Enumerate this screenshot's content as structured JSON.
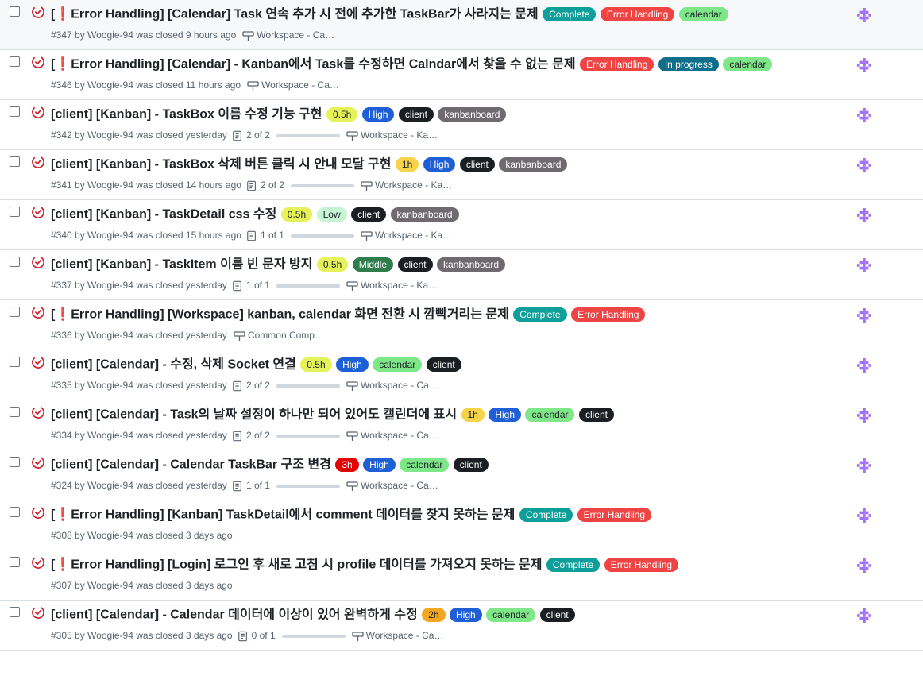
{
  "colors": {
    "status_closed": "#cf222e",
    "avatar": "#a371f7"
  },
  "labels": {
    "complete": {
      "bg": "#0e9f9a",
      "fg": "#ffffff"
    },
    "error_handling": {
      "bg": "#ef4444",
      "fg": "#ffffff"
    },
    "calendar": {
      "bg": "#7ee787",
      "fg": "#1f2328"
    },
    "in_progress": {
      "bg": "#0e6e8c",
      "fg": "#ffffff"
    },
    "h05": {
      "bg": "#e6f25a",
      "fg": "#1f2328"
    },
    "h1": {
      "bg": "#f6d349",
      "fg": "#1f2328"
    },
    "h2": {
      "bg": "#f5a623",
      "fg": "#1f2328"
    },
    "h3": {
      "bg": "#e50000",
      "fg": "#ffffff"
    },
    "high": {
      "bg": "#1f5fd6",
      "fg": "#ffffff"
    },
    "low": {
      "bg": "#c6f5d3",
      "fg": "#1f2328"
    },
    "middle": {
      "bg": "#2f7d4b",
      "fg": "#ffffff"
    },
    "client": {
      "bg": "#1b1f24",
      "fg": "#ffffff"
    },
    "kanbanboard": {
      "bg": "#6e6a70",
      "fg": "#ffffff"
    }
  },
  "issues": [
    {
      "title": "[❗Error Handling] [Calendar] Task 연속 추가 시 전에 추가한 TaskBar가 사라지는 문제",
      "labels": [
        {
          "text": "Complete",
          "style": "complete"
        },
        {
          "text": "Error Handling",
          "style": "error_handling"
        },
        {
          "text": "calendar",
          "style": "calendar"
        }
      ],
      "number": "#347",
      "meta": "by Woogie-94 was closed 9 hours ago",
      "tasks": null,
      "progress": null,
      "project": "Workspace - Ca…",
      "highlight": true
    },
    {
      "title": "[❗Error Handling] [Calendar] - Kanban에서 Task를 수정하면 Calndar에서 찾을 수 없는 문제",
      "labels": [
        {
          "text": "Error Handling",
          "style": "error_handling"
        },
        {
          "text": "In progress",
          "style": "in_progress"
        },
        {
          "text": "calendar",
          "style": "calendar"
        }
      ],
      "number": "#346",
      "meta": "by Woogie-94 was closed 11 hours ago",
      "tasks": null,
      "progress": null,
      "project": "Workspace - Ca…",
      "highlight": false
    },
    {
      "title": "[client] [Kanban] - TaskBox 이름 수정 기능 구현",
      "labels": [
        {
          "text": "0.5h",
          "style": "h05"
        },
        {
          "text": "High",
          "style": "high"
        },
        {
          "text": "client",
          "style": "client"
        },
        {
          "text": "kanbanboard",
          "style": "kanbanboard"
        }
      ],
      "number": "#342",
      "meta": "by Woogie-94 was closed yesterday",
      "tasks": "2 of 2",
      "progress": 1,
      "project": "Workspace - Ka…",
      "highlight": false
    },
    {
      "title": "[client] [Kanban] - TaskBox 삭제 버튼 클릭 시 안내 모달 구현",
      "labels": [
        {
          "text": "1h",
          "style": "h1"
        },
        {
          "text": "High",
          "style": "high"
        },
        {
          "text": "client",
          "style": "client"
        },
        {
          "text": "kanbanboard",
          "style": "kanbanboard"
        }
      ],
      "number": "#341",
      "meta": "by Woogie-94 was closed 14 hours ago",
      "tasks": "2 of 2",
      "progress": 1,
      "project": "Workspace - Ka…",
      "highlight": false
    },
    {
      "title": "[client] [Kanban] - TaskDetail css 수정",
      "labels": [
        {
          "text": "0.5h",
          "style": "h05"
        },
        {
          "text": "Low",
          "style": "low"
        },
        {
          "text": "client",
          "style": "client"
        },
        {
          "text": "kanbanboard",
          "style": "kanbanboard"
        }
      ],
      "number": "#340",
      "meta": "by Woogie-94 was closed 15 hours ago",
      "tasks": "1 of 1",
      "progress": 1,
      "project": "Workspace - Ka…",
      "highlight": false
    },
    {
      "title": "[client] [Kanban] - TaskItem 이름 빈 문자 방지",
      "labels": [
        {
          "text": "0.5h",
          "style": "h05"
        },
        {
          "text": "Middle",
          "style": "middle"
        },
        {
          "text": "client",
          "style": "client"
        },
        {
          "text": "kanbanboard",
          "style": "kanbanboard"
        }
      ],
      "number": "#337",
      "meta": "by Woogie-94 was closed yesterday",
      "tasks": "1 of 1",
      "progress": 1,
      "project": "Workspace - Ka…",
      "highlight": false
    },
    {
      "title": "[❗Error Handling] [Workspace] kanban, calendar 화면 전환 시 깜빡거리는 문제",
      "labels": [
        {
          "text": "Complete",
          "style": "complete"
        },
        {
          "text": "Error Handling",
          "style": "error_handling"
        }
      ],
      "number": "#336",
      "meta": "by Woogie-94 was closed yesterday",
      "tasks": null,
      "progress": null,
      "project": "Common Comp…",
      "highlight": false
    },
    {
      "title": "[client] [Calendar] - 수정, 삭제 Socket 연결",
      "labels": [
        {
          "text": "0.5h",
          "style": "h05"
        },
        {
          "text": "High",
          "style": "high"
        },
        {
          "text": "calendar",
          "style": "calendar"
        },
        {
          "text": "client",
          "style": "client"
        }
      ],
      "number": "#335",
      "meta": "by Woogie-94 was closed yesterday",
      "tasks": "2 of 2",
      "progress": 1,
      "project": "Workspace - Ca…",
      "highlight": false
    },
    {
      "title": "[client] [Calendar] - Task의 날짜 설정이 하나만 되어 있어도 캘린더에 표시",
      "labels": [
        {
          "text": "1h",
          "style": "h1"
        },
        {
          "text": "High",
          "style": "high"
        },
        {
          "text": "calendar",
          "style": "calendar"
        },
        {
          "text": "client",
          "style": "client"
        }
      ],
      "number": "#334",
      "meta": "by Woogie-94 was closed yesterday",
      "tasks": "2 of 2",
      "progress": 1,
      "project": "Workspace - Ca…",
      "highlight": false
    },
    {
      "title": "[client] [Calendar] - Calendar TaskBar 구조 변경",
      "labels": [
        {
          "text": "3h",
          "style": "h3"
        },
        {
          "text": "High",
          "style": "high"
        },
        {
          "text": "calendar",
          "style": "calendar"
        },
        {
          "text": "client",
          "style": "client"
        }
      ],
      "number": "#324",
      "meta": "by Woogie-94 was closed yesterday",
      "tasks": "1 of 1",
      "progress": 1,
      "project": "Workspace - Ca…",
      "highlight": false
    },
    {
      "title": "[❗Error Handling] [Kanban] TaskDetail에서 comment 데이터를 찾지 못하는 문제",
      "labels": [
        {
          "text": "Complete",
          "style": "complete"
        },
        {
          "text": "Error Handling",
          "style": "error_handling"
        }
      ],
      "number": "#308",
      "meta": "by Woogie-94 was closed 3 days ago",
      "tasks": null,
      "progress": null,
      "project": null,
      "highlight": false
    },
    {
      "title": "[❗Error Handling] [Login] 로그인 후 새로 고침 시 profile 데이터를 가져오지 못하는 문제",
      "labels": [
        {
          "text": "Complete",
          "style": "complete"
        },
        {
          "text": "Error Handling",
          "style": "error_handling"
        }
      ],
      "number": "#307",
      "meta": "by Woogie-94 was closed 3 days ago",
      "tasks": null,
      "progress": null,
      "project": null,
      "highlight": false
    },
    {
      "title": "[client] [Calendar] - Calendar 데이터에 이상이 있어 완벽하게 수정",
      "labels": [
        {
          "text": "2h",
          "style": "h2"
        },
        {
          "text": "High",
          "style": "high"
        },
        {
          "text": "calendar",
          "style": "calendar"
        },
        {
          "text": "client",
          "style": "client"
        }
      ],
      "number": "#305",
      "meta": "by Woogie-94 was closed 3 days ago",
      "tasks": "0 of 1",
      "progress": 0,
      "project": "Workspace - Ca…",
      "highlight": false
    }
  ]
}
